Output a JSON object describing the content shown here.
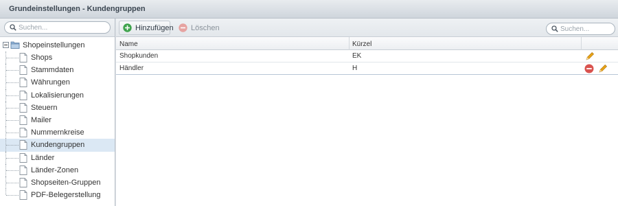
{
  "window": {
    "title": "Grundeinstellungen - Kundengruppen"
  },
  "left_search": {
    "placeholder": "Suchen..."
  },
  "tree": {
    "root_label": "Shopeinstellungen",
    "items": [
      {
        "label": "Shops",
        "selected": false
      },
      {
        "label": "Stammdaten",
        "selected": false
      },
      {
        "label": "Währungen",
        "selected": false
      },
      {
        "label": "Lokalisierungen",
        "selected": false
      },
      {
        "label": "Steuern",
        "selected": false
      },
      {
        "label": "Mailer",
        "selected": false
      },
      {
        "label": "Nummernkreise",
        "selected": false
      },
      {
        "label": "Kundengruppen",
        "selected": true
      },
      {
        "label": "Länder",
        "selected": false
      },
      {
        "label": "Länder-Zonen",
        "selected": false
      },
      {
        "label": "Shopseiten-Gruppen",
        "selected": false
      },
      {
        "label": "PDF-Belegerstellung",
        "selected": false
      }
    ]
  },
  "toolbar": {
    "add_label": "Hinzufügen",
    "delete_label": "Löschen",
    "search_placeholder": "Suchen..."
  },
  "grid": {
    "columns": {
      "name": "Name",
      "code": "Kürzel"
    },
    "rows": [
      {
        "name": "Shopkunden",
        "code": "EK",
        "deletable": false
      },
      {
        "name": "Händler",
        "code": "H",
        "deletable": true
      }
    ]
  },
  "colors": {
    "add_green": "#3fa34d",
    "delete_red": "#d9534f",
    "edit_orange": "#e8a317",
    "selected_row": "#dbe8f4"
  }
}
